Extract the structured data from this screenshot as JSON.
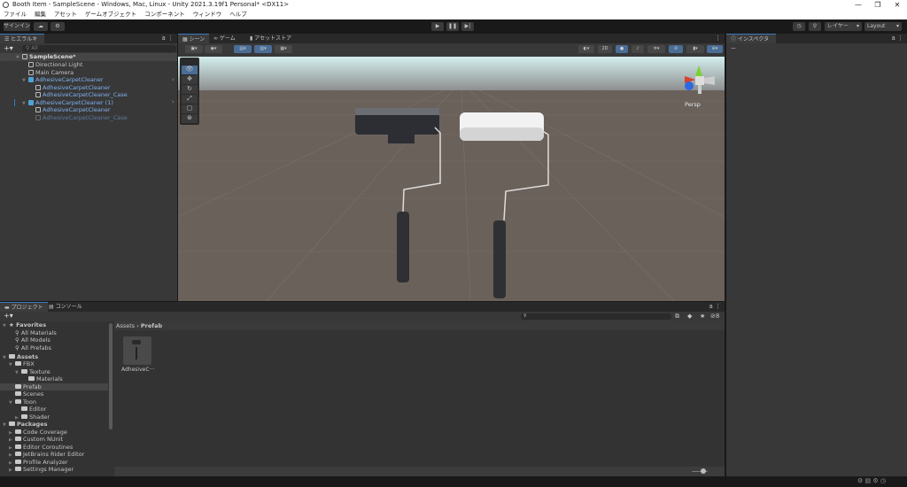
{
  "window": {
    "title": "Booth Item - SampleScene - Windows, Mac, Linux - Unity 2021.3.19f1 Personal* <DX11>",
    "minimize": "—",
    "maximize": "❐",
    "close": "✕"
  },
  "menu": [
    "ファイル",
    "編集",
    "アセット",
    "ゲームオブジェクト",
    "コンポーネント",
    "ウィンドウ",
    "ヘルプ"
  ],
  "toolbar": {
    "signin": "サインイン",
    "play": "▶",
    "pause": "❚❚",
    "step": "▶|",
    "layers": "レイヤー",
    "layout": "Layout"
  },
  "hierarchy": {
    "tab": "ヒエラルキー",
    "search_placeholder": "All",
    "add": "+▾",
    "items": [
      {
        "label": "SampleScene*"
      },
      {
        "label": "Directional Light"
      },
      {
        "label": "Main Camera"
      },
      {
        "label": "AdhesiveCarpetCleaner"
      },
      {
        "label": "AdhesiveCarpetCleaner"
      },
      {
        "label": "AdhesiveCarpetCleaner_Case"
      },
      {
        "label": "AdhesiveCarpetCleaner (1)"
      },
      {
        "label": "AdhesiveCarpetCleaner"
      },
      {
        "label": "AdhesiveCarpetCleaner_Case"
      }
    ]
  },
  "scene": {
    "tabs": [
      "シーン",
      "ゲーム",
      "アセットストア"
    ],
    "mode_2d": "2D",
    "persp": "Persp"
  },
  "inspector": {
    "tab": "インスペクター"
  },
  "project": {
    "tabs": [
      "プロジェクト",
      "コンソール"
    ],
    "add": "+▾",
    "breadcrumb": [
      "Assets",
      "Prefab"
    ],
    "hidden_count": "8",
    "tree": [
      {
        "label": "Favorites"
      },
      {
        "label": "All Materials"
      },
      {
        "label": "All Models"
      },
      {
        "label": "All Prefabs"
      },
      {
        "label": "Assets"
      },
      {
        "label": "FBX"
      },
      {
        "label": "Texture"
      },
      {
        "label": "Materials"
      },
      {
        "label": "Prefab"
      },
      {
        "label": "Scenes"
      },
      {
        "label": "Toon"
      },
      {
        "label": "Editor"
      },
      {
        "label": "Shader"
      },
      {
        "label": "Packages"
      },
      {
        "label": "Code Coverage"
      },
      {
        "label": "Custom NUnit"
      },
      {
        "label": "Editor Coroutines"
      },
      {
        "label": "JetBrains Rider Editor"
      },
      {
        "label": "Profile Analyzer"
      },
      {
        "label": "Settings Manager"
      }
    ],
    "assets": [
      {
        "label": "AdhesiveC···"
      }
    ],
    "zoom_slider": 0.6
  }
}
